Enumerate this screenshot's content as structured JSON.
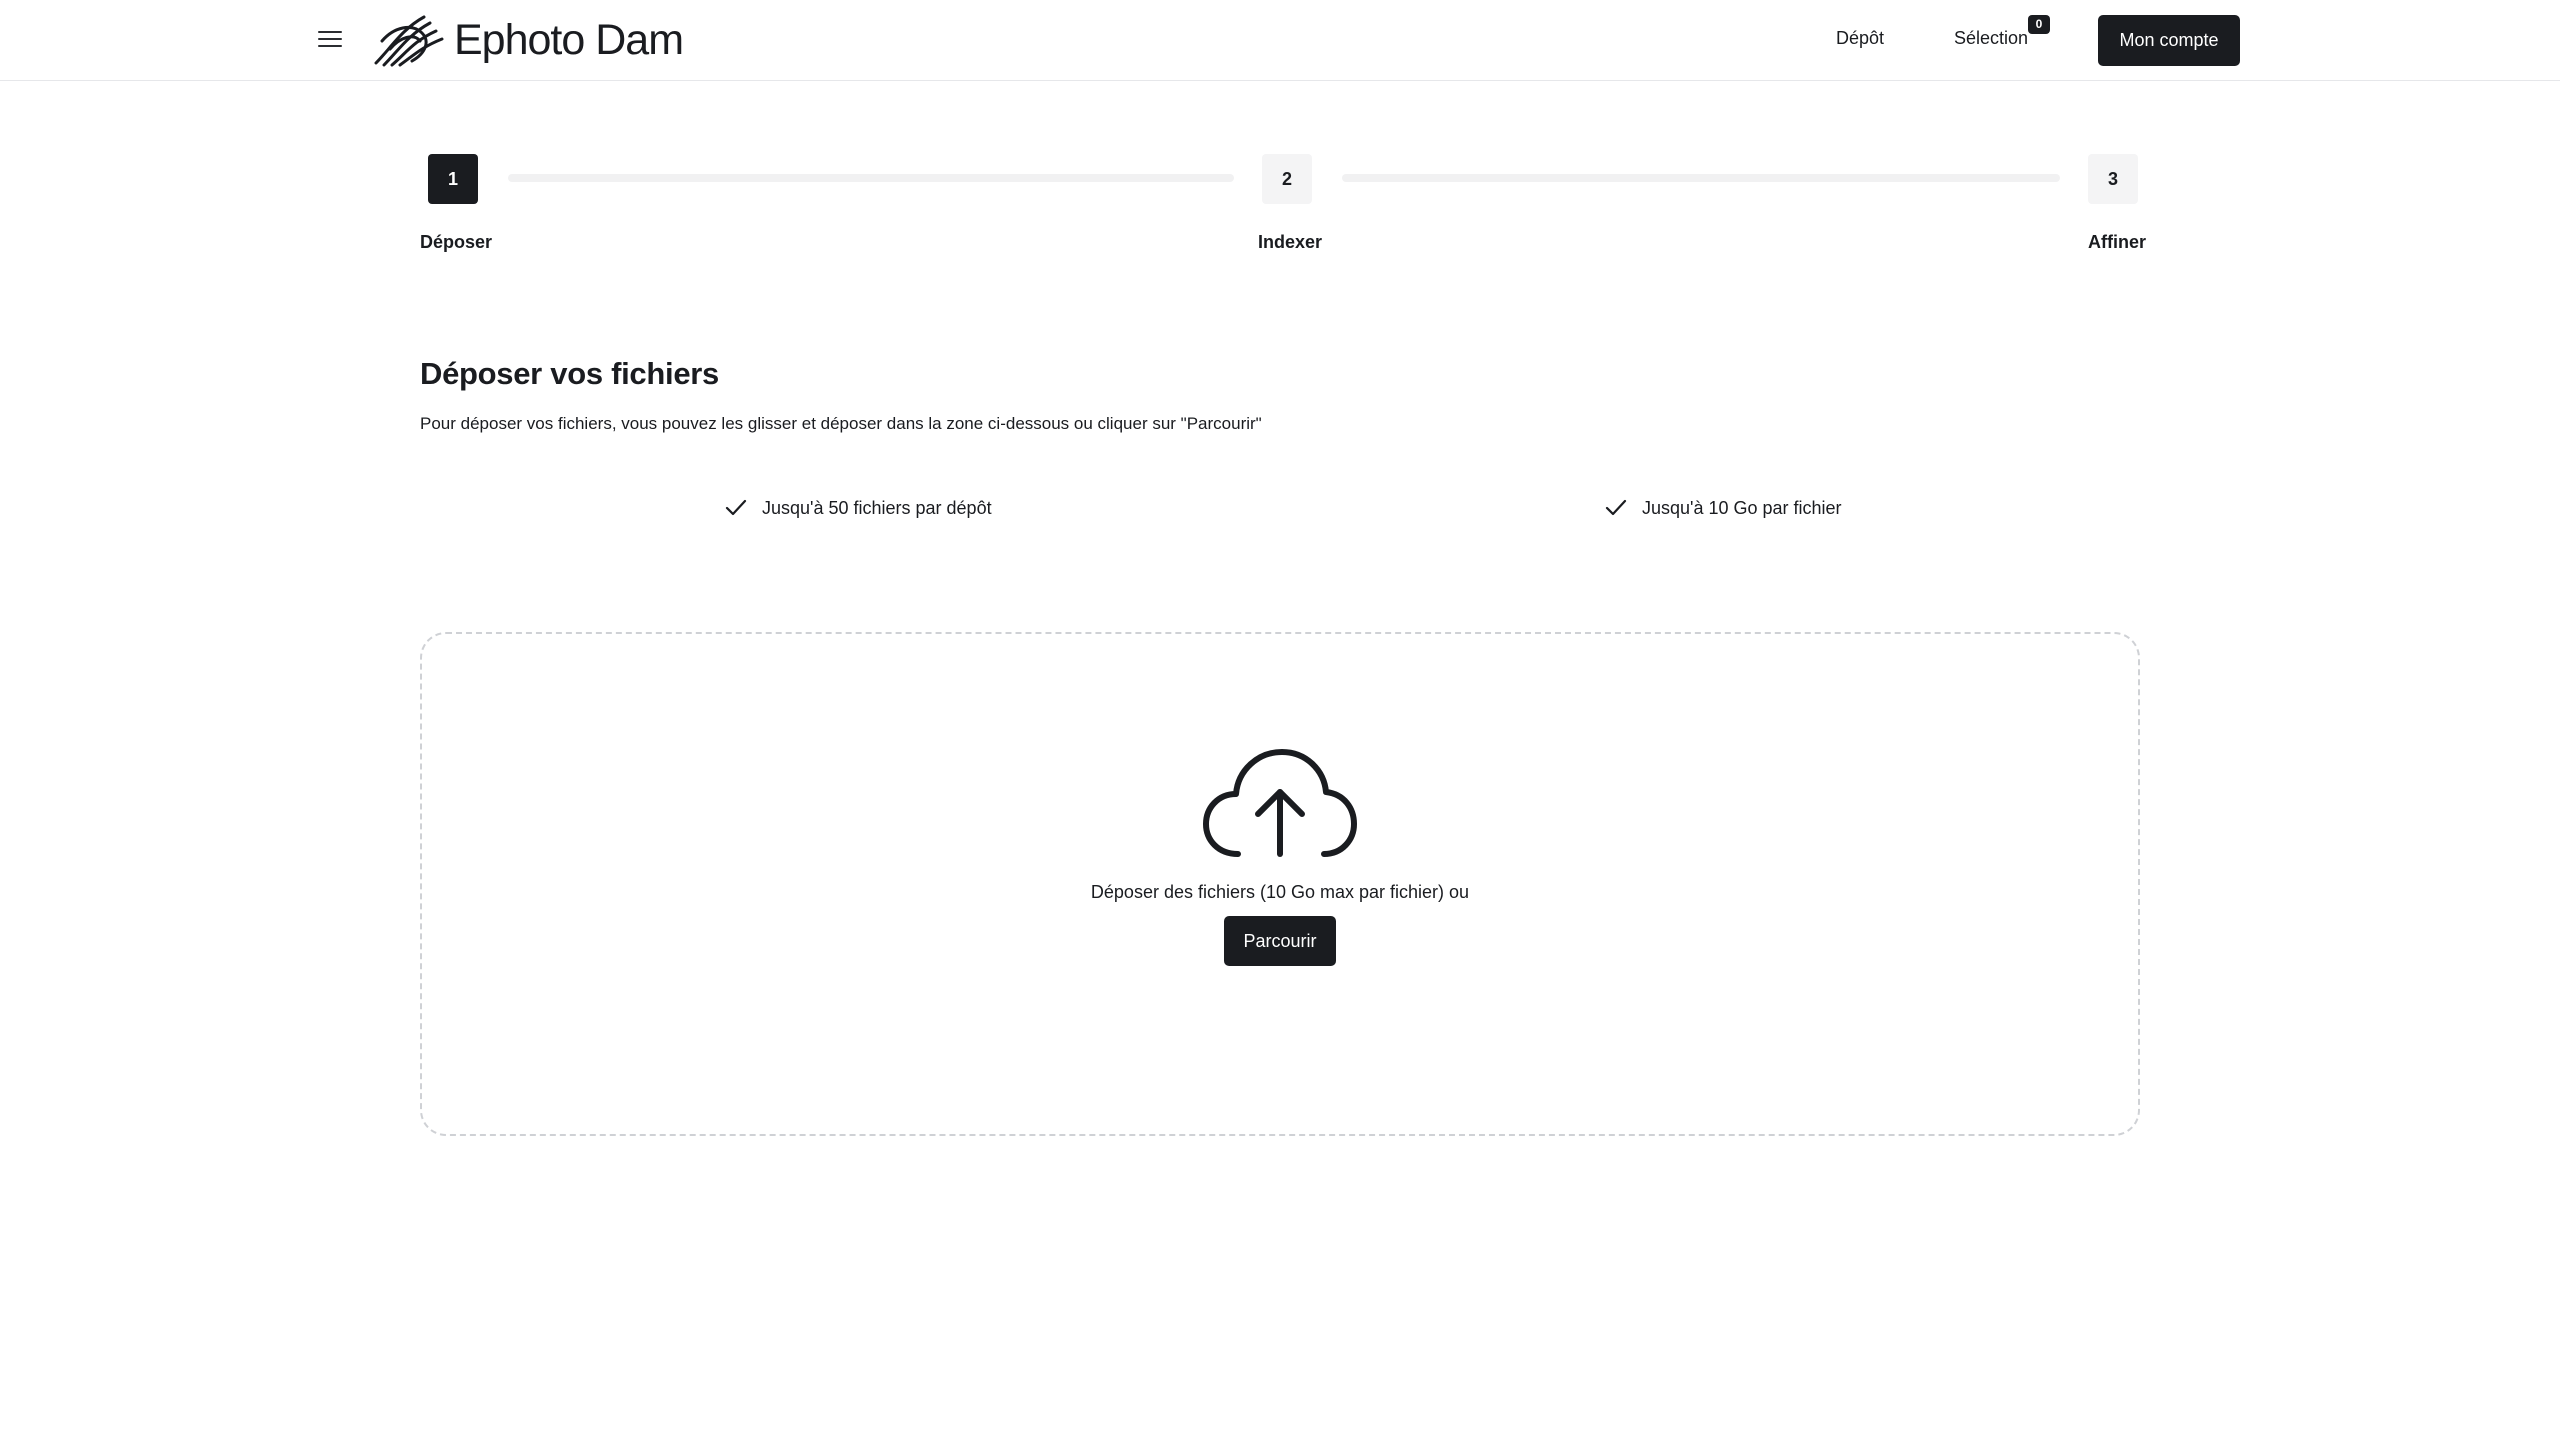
{
  "header": {
    "brand": "Ephoto Dam",
    "nav": {
      "depot_label": "Dépôt",
      "selection_label": "Sélection",
      "selection_count": "0",
      "account_label": "Mon compte"
    }
  },
  "stepper": {
    "steps": [
      {
        "number": "1",
        "label": "Déposer",
        "state": "active"
      },
      {
        "number": "2",
        "label": "Indexer",
        "state": "inactive"
      },
      {
        "number": "3",
        "label": "Affiner",
        "state": "inactive"
      }
    ]
  },
  "main": {
    "title": "Déposer vos fichiers",
    "intro": "Pour déposer vos fichiers, vous pouvez les glisser et déposer dans la zone ci-dessous ou cliquer sur \"Parcourir\"",
    "features": [
      {
        "icon": "check-icon",
        "text": "Jusqu'à 50 fichiers par dépôt"
      },
      {
        "icon": "check-icon",
        "text": "Jusqu'à 10 Go par fichier"
      }
    ]
  },
  "dropzone": {
    "icon": "cloud-upload-icon",
    "text": "Déposer des fichiers (10 Go max par fichier) ou",
    "browse_label": "Parcourir"
  },
  "colors": {
    "primary": "#1a1c20",
    "step_inactive_bg": "#f4f4f5",
    "progress_track": "#f1f1f2",
    "dropzone_border": "#cfd1d5"
  }
}
